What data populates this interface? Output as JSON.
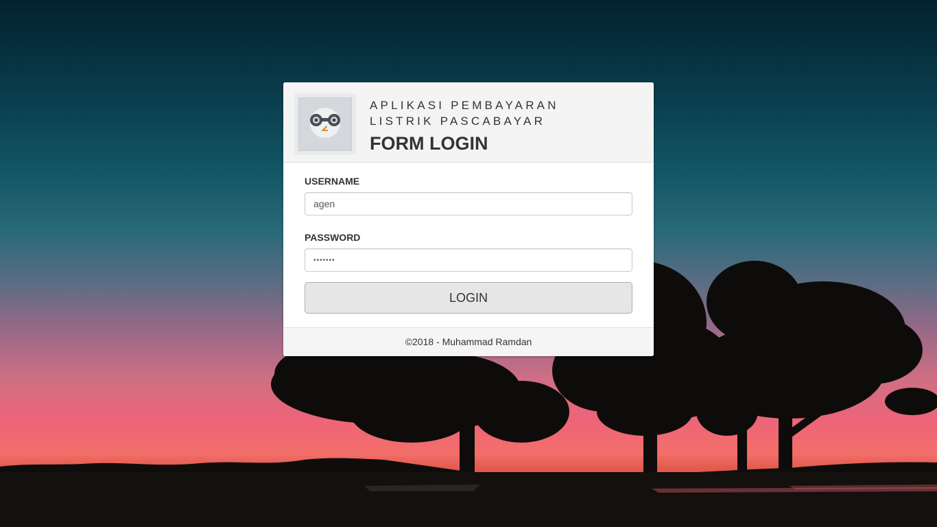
{
  "header": {
    "app_title_line1": "APLIKASI PEMBAYARAN",
    "app_title_line2": "LISTRIK PASCABAYAR",
    "form_title": "FORM LOGIN",
    "logo_icon": "owl-logo-icon"
  },
  "form": {
    "username_label": "USERNAME",
    "username_value": "agen",
    "password_label": "PASSWORD",
    "password_value": "1234567",
    "login_label": "LOGIN"
  },
  "footer": {
    "copyright": "©2018 - Muhammad Ramdan"
  },
  "colors": {
    "panel_heading_bg": "#f4f4f4",
    "button_bg": "#e6e6e6",
    "sky_top": "#04222e",
    "sky_horizon": "#ee6478"
  }
}
